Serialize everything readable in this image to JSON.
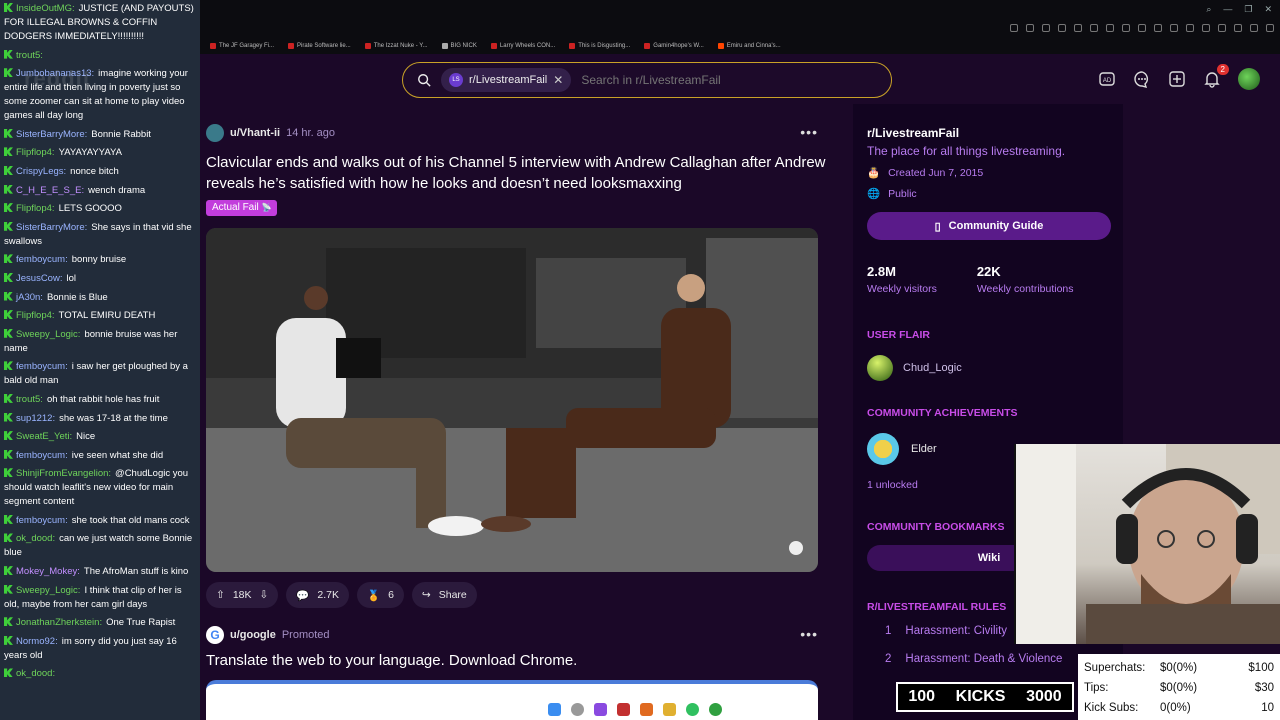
{
  "bookmarks": [
    "The JF Garagey Fi...",
    "Pirate Software lie...",
    "The Izzat Nuke - Y...",
    "BIG NICK",
    "Larry Wheels CON...",
    "This is Disgusting...",
    "Gamin4hope's W...",
    "Emiru and Cinna's..."
  ],
  "chat": {
    "watermark": "reddit",
    "messages": [
      {
        "user": "InsideOutMG",
        "text": "JUSTICE (AND PAYOUTS) FOR ILLEGAL BROWNS & COFFIN DODGERS IMMEDIATELY!!!!!!!!!!",
        "color": "g"
      },
      {
        "user": "trout5",
        "text": "",
        "color": "g"
      },
      {
        "user": "Jumbobananas13",
        "text": "imagine working your entire life and then living in poverty just so some zoomer can sit at home to play video games all day long",
        "color": "b"
      },
      {
        "user": "SisterBarryMore",
        "text": "Bonnie Rabbit",
        "color": "b"
      },
      {
        "user": "Flipflop4",
        "text": "YAYAYAYYAYA",
        "color": "g"
      },
      {
        "user": "CrispyLegs",
        "text": "nonce bitch",
        "color": "b"
      },
      {
        "user": "C_H_E_E_S_E",
        "text": "wench drama",
        "color": "p"
      },
      {
        "user": "Flipflop4",
        "text": "LETS GOOOO",
        "color": "g"
      },
      {
        "user": "SisterBarryMore",
        "text": "She says in that vid she swallows",
        "color": "b"
      },
      {
        "user": "femboycum",
        "text": "bonny bruise",
        "color": "b"
      },
      {
        "user": "JesusCow",
        "text": "lol",
        "color": "b"
      },
      {
        "user": "jA30n",
        "text": "Bonnie is Blue",
        "color": "b"
      },
      {
        "user": "Flipflop4",
        "text": "TOTAL EMIRU DEATH",
        "color": "g"
      },
      {
        "user": "Sweepy_Logic",
        "text": "bonnie bruise was her name",
        "color": "g"
      },
      {
        "user": "femboycum",
        "text": "i saw her get ploughed by a bald old man",
        "color": "b"
      },
      {
        "user": "trout5",
        "text": "oh that rabbit hole has fruit",
        "color": "g"
      },
      {
        "user": "sup1212",
        "text": "she was 17-18 at the time",
        "color": "b"
      },
      {
        "user": "SweatE_Yeti",
        "text": "Nice",
        "color": "g"
      },
      {
        "user": "femboycum",
        "text": "ive seen what she did",
        "color": "b"
      },
      {
        "user": "ShinjiFromEvangelion",
        "text": "@ChudLogic you should watch leaflit's new video for main segment content",
        "color": "g"
      },
      {
        "user": "femboycum",
        "text": "she took that old mans cock",
        "color": "b"
      },
      {
        "user": "ok_dood",
        "text": "can we just watch some Bonnie blue",
        "color": "g"
      },
      {
        "user": "Mokey_Mokey",
        "text": "The AfroMan stuff is kino",
        "color": "p"
      },
      {
        "user": "Sweepy_Logic",
        "text": "I think that clip of her is old, maybe from her cam girl days",
        "color": "g"
      },
      {
        "user": "JonathanZherkstein",
        "text": "One True Rapist",
        "color": "g"
      },
      {
        "user": "Normo92",
        "text": "im sorry did you just say 16 years old",
        "color": "b"
      },
      {
        "user": "ok_dood",
        "text": "",
        "color": "g"
      }
    ]
  },
  "search": {
    "chip_icon": "LS",
    "chip_label": "r/LivestreamFail",
    "placeholder": "Search in r/LivestreamFail"
  },
  "header": {
    "notification_count": "2",
    "accent": "#c9a227"
  },
  "post": {
    "user": "u/Vhant-ii",
    "time": "14 hr. ago",
    "title": "Clavicular ends and walks out of his Channel 5 interview with Andrew Callaghan after Andrew reveals he’s satisfied with how he looks and doesn’t need looksmaxxing",
    "flair": "Actual Fail",
    "votes": "18K",
    "comments": "2.7K",
    "awards": "6",
    "share": "Share"
  },
  "promo": {
    "logo": "G",
    "user": "u/google",
    "tag": "Promoted",
    "title": "Translate the web to your language. Download Chrome."
  },
  "sidebar": {
    "name": "r/LivestreamFail",
    "description": "The place for all things livestreaming.",
    "created": "Created Jun 7, 2015",
    "visibility": "Public",
    "guide_button": "Community Guide",
    "visitors": "2.8M",
    "visitors_label": "Weekly visitors",
    "contributions": "22K",
    "contributions_label": "Weekly contributions",
    "user_flair_heading": "USER FLAIR",
    "flair_name": "Chud_Logic",
    "achievements_heading": "COMMUNITY ACHIEVEMENTS",
    "achievement": "Elder",
    "unlocked": "1 unlocked",
    "bookmarks_heading": "COMMUNITY BOOKMARKS",
    "wiki": "Wiki",
    "rules_heading": "R/LIVESTREAMFAIL RULES",
    "rules": [
      {
        "num": "1",
        "text": "Harassment: Civility"
      },
      {
        "num": "2",
        "text": "Harassment: Death & Violence"
      }
    ]
  },
  "donations": {
    "rows": [
      {
        "label": "Superchats:",
        "value": "$0(0%)",
        "goal": "$100"
      },
      {
        "label": "Tips:",
        "value": "$0(0%)",
        "goal": "$30"
      },
      {
        "label": "Kick Subs:",
        "value": "0(0%)",
        "goal": "10"
      }
    ]
  },
  "kicks": {
    "left": "100",
    "label": "KICKS",
    "right": "3000"
  }
}
